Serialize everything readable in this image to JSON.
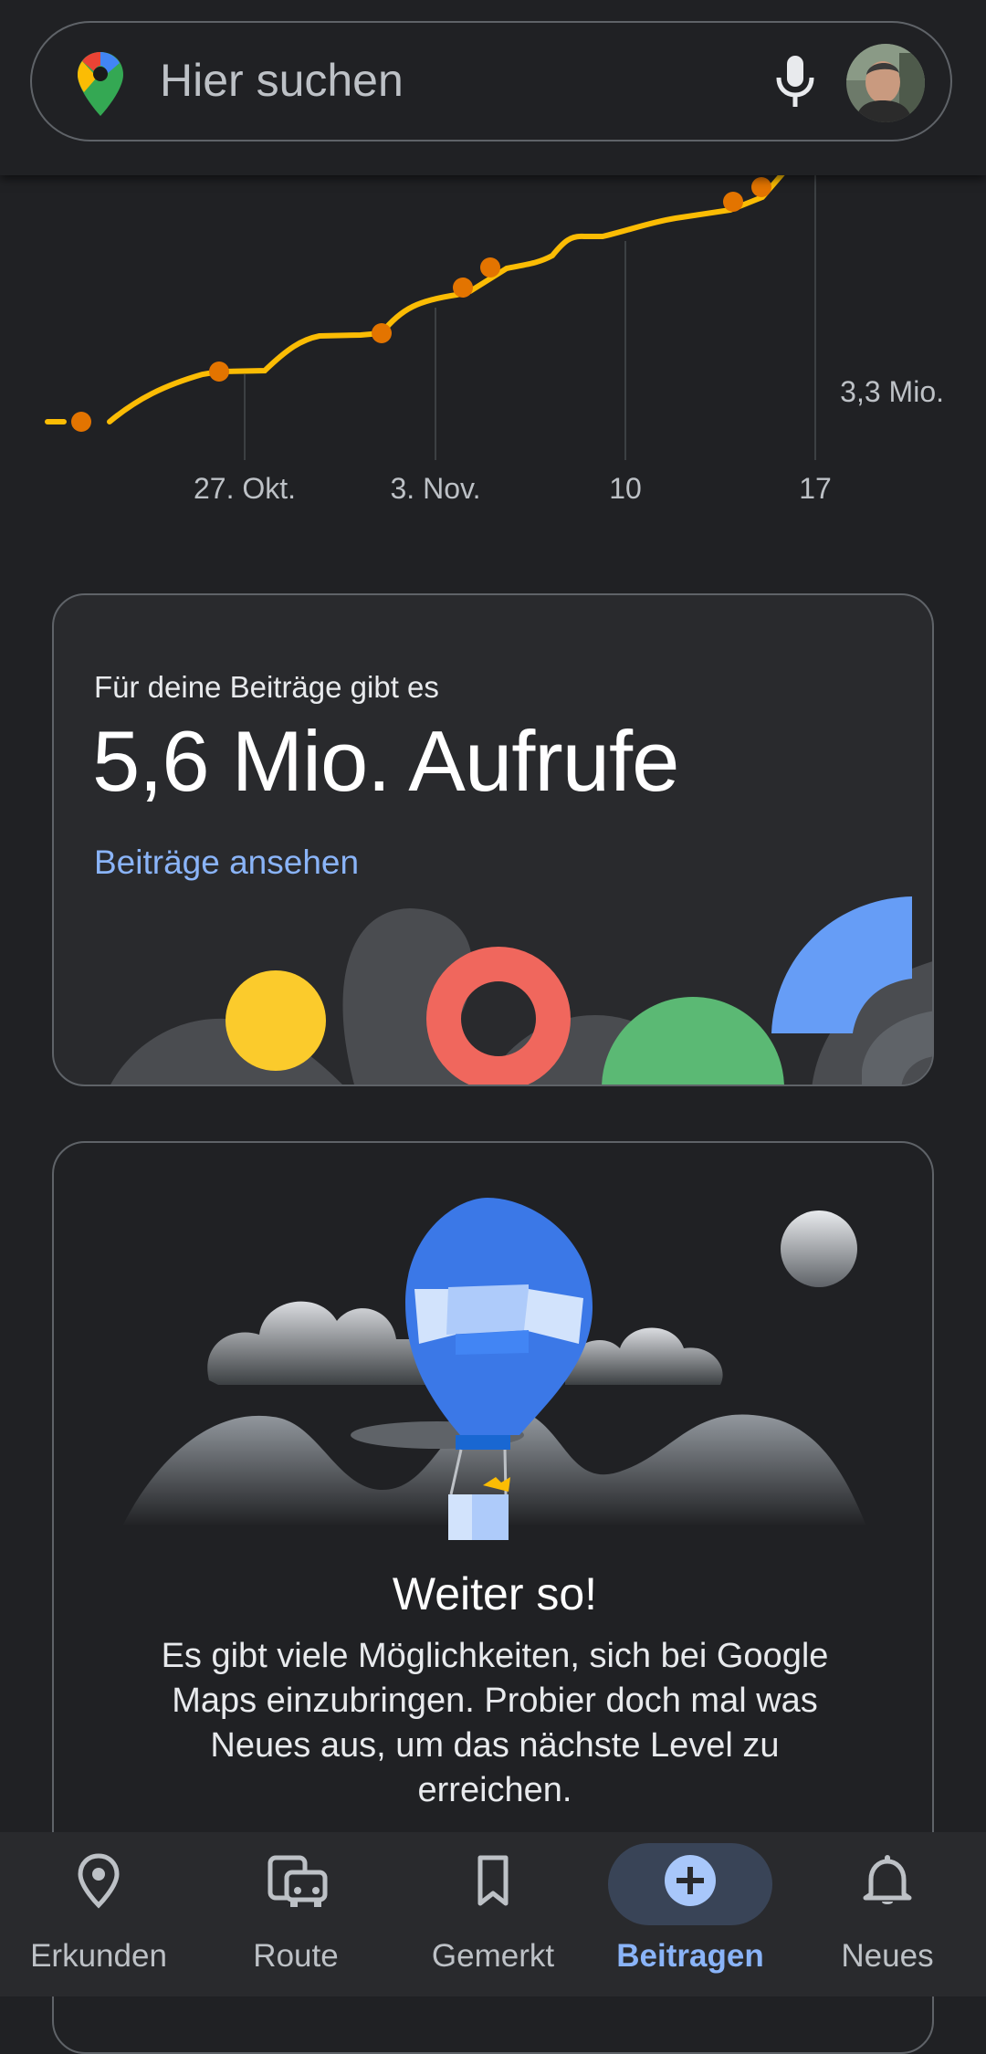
{
  "search": {
    "placeholder": "Hier suchen"
  },
  "chart_data": {
    "type": "line",
    "x_tick_labels": [
      "27. Okt.",
      "3. Nov.",
      "10",
      "17"
    ],
    "y_tick_labels": [
      "3,3 Mio."
    ],
    "colors": {
      "line": "#fbbc04",
      "markers": "#e37400"
    }
  },
  "views_card": {
    "subtitle": "Für deine Beiträge gibt es",
    "value": "5,6 Mio. Aufrufe",
    "link": "Beiträge ansehen"
  },
  "level_card": {
    "title": "Weiter so!",
    "body": "Es gibt viele Möglichkeiten, sich bei Google Maps einzubringen. Probier doch mal was Neues aus, um das nächste Level zu erreichen."
  },
  "nav": {
    "items": [
      {
        "label": "Erkunden",
        "icon": "location-pin-icon"
      },
      {
        "label": "Route",
        "icon": "commute-icon"
      },
      {
        "label": "Gemerkt",
        "icon": "bookmark-icon"
      },
      {
        "label": "Beitragen",
        "icon": "add-circle-icon",
        "active": true
      },
      {
        "label": "Neues",
        "icon": "bell-icon"
      }
    ]
  },
  "colors": {
    "background": "#202124",
    "accent": "#8ab4f8",
    "active_pill": "#394457"
  }
}
